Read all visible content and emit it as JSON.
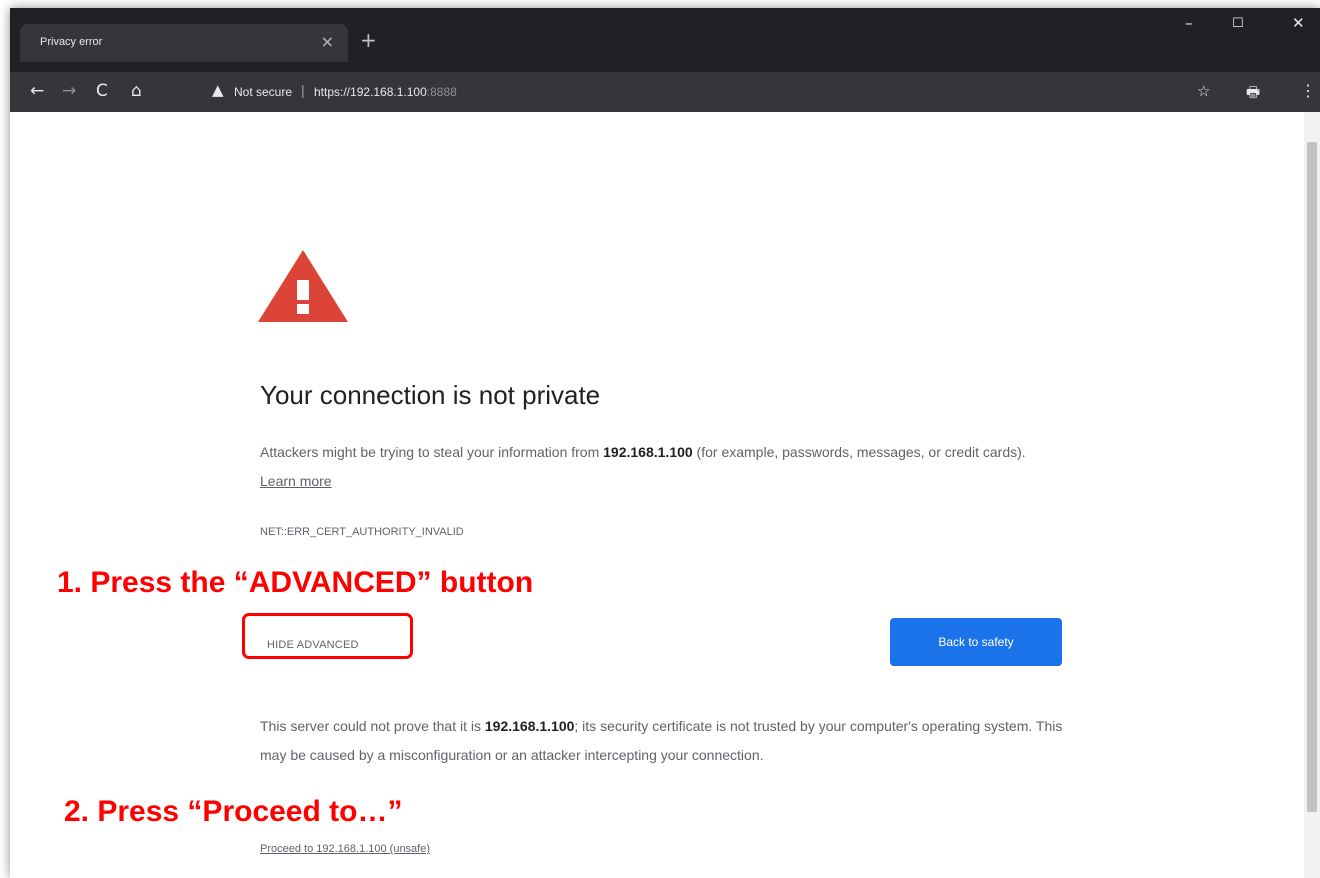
{
  "browser": {
    "tab_title": "Privacy error",
    "tab_close_icon": "×",
    "new_tab_icon": "+",
    "window_controls": {
      "minimize": "–",
      "maximize": "☐",
      "close": "✕"
    },
    "toolbar": {
      "back_icon": "←",
      "forward_icon": "→",
      "reload_icon": "C",
      "home_icon": "⌂",
      "warning_icon": "▲",
      "not_secure_label": "Not secure",
      "separator": "|",
      "url_scheme": "https",
      "url_host": "://192.168.1.100",
      "url_port": ":8888",
      "star_icon": "☆",
      "extension_icon": "🖶",
      "menu_icon": "⋮"
    }
  },
  "page": {
    "heading": "Your connection is not private",
    "intro_prefix": "Attackers might be trying to steal your information from ",
    "host": "192.168.1.100",
    "intro_suffix": " (for example, passwords, messages, or credit cards). ",
    "learn_more": "Learn more",
    "error_code": "NET::ERR_CERT_AUTHORITY_INVALID",
    "hide_advanced": "HIDE ADVANCED",
    "back_button": "Back to safety",
    "details_prefix": "This server could not prove that it is ",
    "details_host": "192.168.1.100",
    "details_suffix": "; its security certificate is not trusted by your computer's operating system. This may be caused by a misconfiguration or an attacker intercepting your connection.",
    "proceed_link": "Proceed to 192.168.1.100 (unsafe)"
  },
  "annotations": {
    "step1": "1. Press the “ADVANCED” button",
    "step2": "2. Press “Proceed to…”",
    "color": "#ff0000"
  },
  "colors": {
    "warning_red": "#db4437",
    "button_blue": "#1a73e8",
    "chrome_dark": "#202124"
  }
}
